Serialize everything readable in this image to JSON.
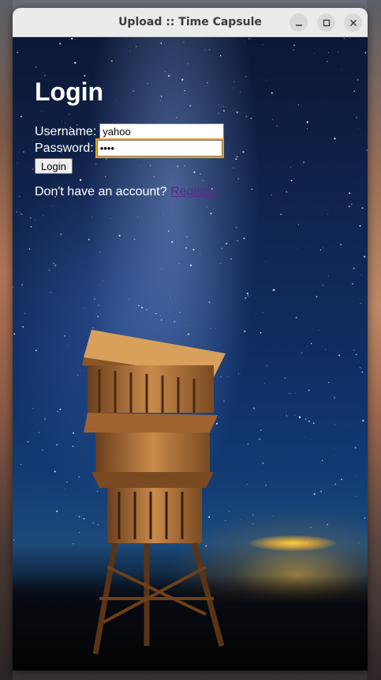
{
  "window": {
    "title": "Upload :: Time Capsule",
    "controls": {
      "minimize_icon": "minimize-icon",
      "maximize_icon": "maximize-icon",
      "close_icon": "close-icon"
    }
  },
  "login": {
    "heading": "Login",
    "username_label": "Username:",
    "username_value": "yahoo",
    "password_label": "Password:",
    "password_value": "••••",
    "submit_label": "Login",
    "signup_prompt": "Don't have an account? ",
    "signup_link": "Register"
  },
  "colors": {
    "focus_outline": "#e8a317",
    "link_visited": "#5b2a8c",
    "text": "#ffffff"
  }
}
